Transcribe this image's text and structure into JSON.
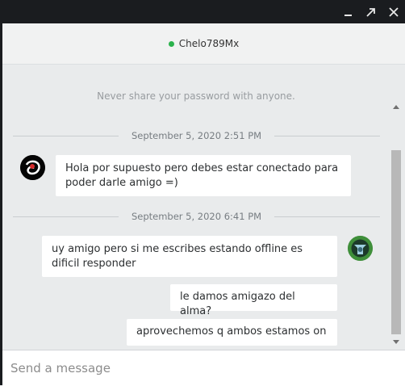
{
  "window": {
    "minimize_icon": "minimize-icon",
    "maximize_icon": "restore-icon",
    "close_icon": "close-icon"
  },
  "header": {
    "contact_name": "Chelo789Mx",
    "status_color": "#2bb24c"
  },
  "conversation": {
    "notice": "Never share your password with anyone.",
    "dividers": [
      {
        "date": "September 5, 2020 2:51 PM"
      },
      {
        "date": "September 5, 2020 6:41 PM"
      }
    ],
    "messages": [
      {
        "from": "contact",
        "text": "Hola por supuesto pero debes estar conectado para poder darle amigo =)"
      },
      {
        "from": "me",
        "text": "uy amigo pero si me escribes estando offline es dificil responder"
      },
      {
        "from": "me",
        "text": "le damos amigazo del alma?"
      },
      {
        "from": "me",
        "text": "aprovechemos q ambos estamos on"
      }
    ]
  },
  "composer": {
    "placeholder": "Send a message",
    "value": ""
  }
}
